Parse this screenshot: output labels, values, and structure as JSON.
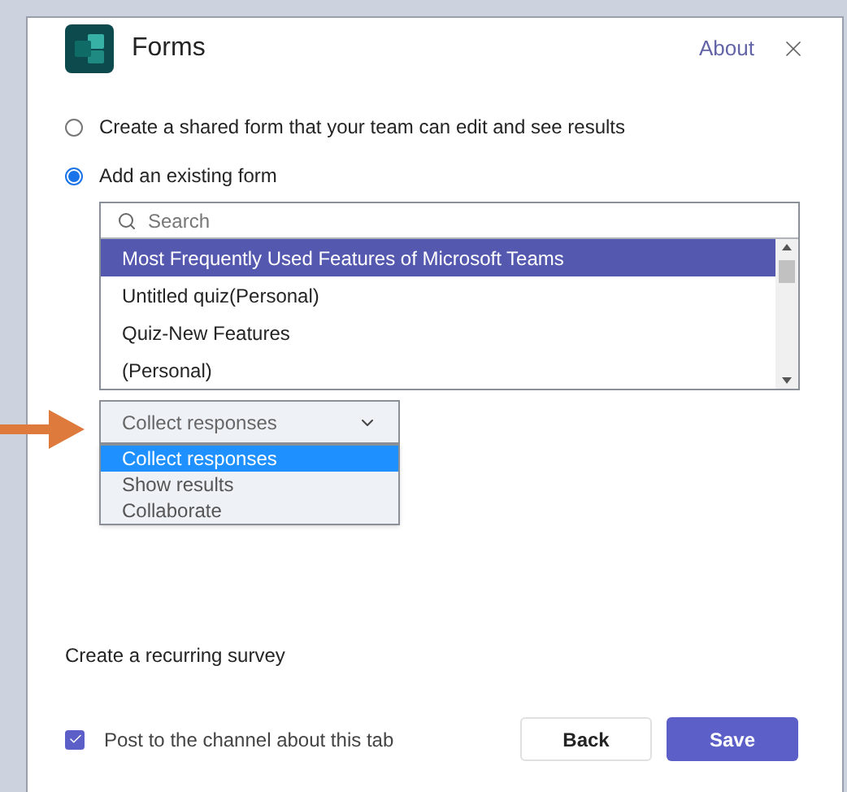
{
  "header": {
    "title": "Forms",
    "about_link": "About"
  },
  "options": [
    {
      "label": "Create a shared form that your team can edit and see results",
      "selected": false
    },
    {
      "label": "Add an existing form",
      "selected": true
    }
  ],
  "form_list": {
    "search": {
      "placeholder": "Search"
    },
    "items": [
      {
        "label": "Most Frequently Used Features of Microsoft Teams",
        "selected": true
      },
      {
        "label": "Untitled quiz(Personal)",
        "selected": false
      },
      {
        "label": "Quiz-New Features",
        "selected": false
      },
      {
        "label": "(Personal)",
        "selected": false
      }
    ]
  },
  "mode_select": {
    "value": "Collect responses",
    "expanded": true,
    "options": [
      {
        "label": "Collect responses",
        "selected": true
      },
      {
        "label": "Show results",
        "selected": false
      },
      {
        "label": "Collaborate",
        "selected": false
      }
    ]
  },
  "recurring_survey": "Create a recurring survey",
  "post_to_channel": {
    "label": "Post to the channel about this tab",
    "checked": true
  },
  "buttons": [
    {
      "label": "Back",
      "kind": "secondary"
    },
    {
      "label": "Save",
      "kind": "primary"
    }
  ]
}
